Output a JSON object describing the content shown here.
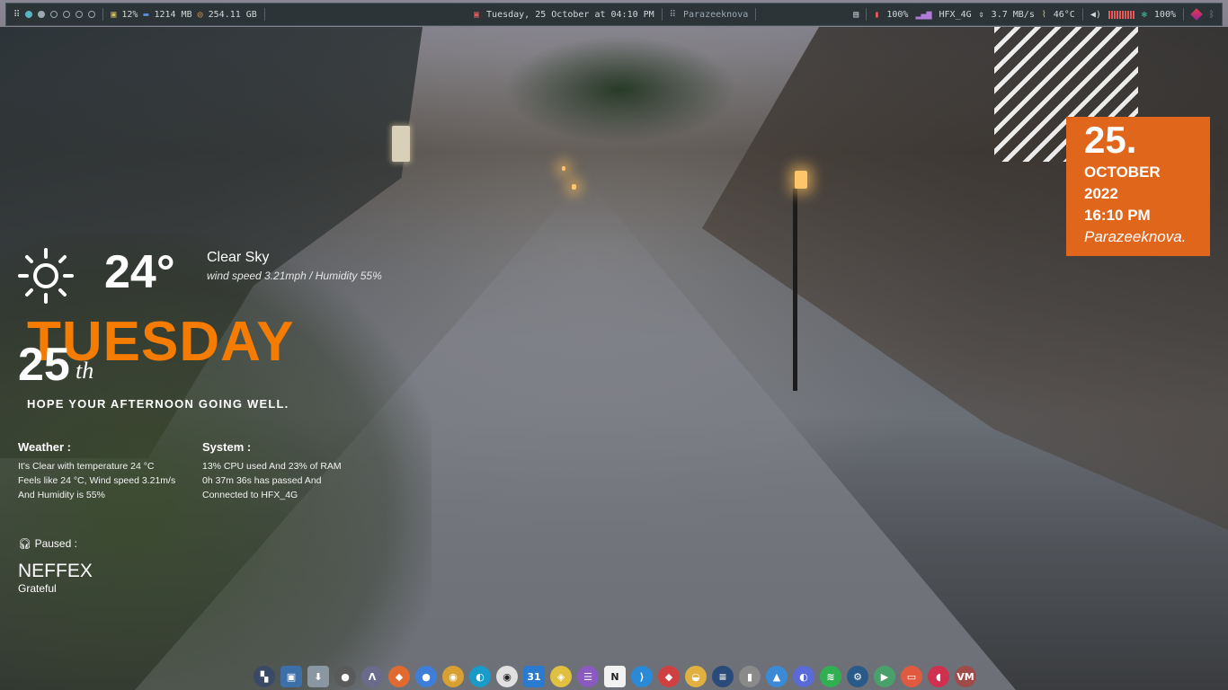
{
  "topbar": {
    "workspaces": [
      "active",
      "occupied",
      "occupied",
      "empty",
      "empty",
      "empty",
      "empty"
    ],
    "cpu": "12%",
    "ram": "1214 MB",
    "disk": "254.11 GB",
    "datetime": "Tuesday, 25 October at 04:10 PM",
    "hostname": "Parazeeknova",
    "battery": "100%",
    "network_name": "HFX_4G",
    "net_speed": "3.7 MB/s",
    "temperature": "46°C",
    "brightness": "100%",
    "volume_level": 1.0
  },
  "weather": {
    "temp": "24°",
    "condition": "Clear Sky",
    "detail": "wind speed 3.21mph / Humidity 55%"
  },
  "day": {
    "name": "TUESDAY",
    "number": "25",
    "suffix": "th",
    "greeting": "HOPE YOUR AFTERNOON  GOING WELL."
  },
  "weather_info": {
    "heading": "Weather :",
    "lines": [
      "It's Clear with temperature 24 °C",
      "Feels like 24 °C, Wind speed 3.21m/s",
      "And Humidity is 55%"
    ]
  },
  "system_info": {
    "heading": "System :",
    "lines": [
      "13% CPU used And 23% of RAM",
      "0h 37m 36s has passed And",
      "Connected to HFX_4G"
    ]
  },
  "media": {
    "status": "Paused :",
    "artist": "NEFFEX",
    "song": "Grateful"
  },
  "clock_card": {
    "date": "25.",
    "month": "OCTOBER",
    "year": "2022",
    "time": "16:10 PM",
    "user": "Parazeeknova."
  },
  "dock": [
    {
      "name": "workspace-switcher",
      "color": "#3a4a66",
      "glyph": "▚"
    },
    {
      "name": "window-manager",
      "color": "#3d6fa8",
      "glyph": "▣"
    },
    {
      "name": "downloads",
      "color": "#8a96a2",
      "glyph": "⬇"
    },
    {
      "name": "camera",
      "color": "#5a5a5a",
      "glyph": "●"
    },
    {
      "name": "archlinux",
      "color": "#6a6a8a",
      "glyph": "Λ"
    },
    {
      "name": "gitlab",
      "color": "#e06a30",
      "glyph": "◆"
    },
    {
      "name": "chromium",
      "color": "#3f7ed8",
      "glyph": "●"
    },
    {
      "name": "chrome",
      "color": "#d8a030",
      "glyph": "◉"
    },
    {
      "name": "edge",
      "color": "#1a9ac8",
      "glyph": "◐"
    },
    {
      "name": "ubuntu",
      "color": "#e0e0e0",
      "glyph": "◉"
    },
    {
      "name": "calendar",
      "color": "#2a7ad0",
      "glyph": "31"
    },
    {
      "name": "ideas",
      "color": "#e0c040",
      "glyph": "◈"
    },
    {
      "name": "tasks",
      "color": "#8a5ac0",
      "glyph": "☰"
    },
    {
      "name": "notion",
      "color": "#f2f2f2",
      "glyph": "N"
    },
    {
      "name": "vscode",
      "color": "#2a8ad8",
      "glyph": "⟩"
    },
    {
      "name": "package",
      "color": "#d04040",
      "glyph": "◆"
    },
    {
      "name": "bowl",
      "color": "#e0b040",
      "glyph": "◒"
    },
    {
      "name": "stacks",
      "color": "#2a4a7a",
      "glyph": "≡"
    },
    {
      "name": "lamp",
      "color": "#8a8a8a",
      "glyph": "▮"
    },
    {
      "name": "drive",
      "color": "#3a8ad8",
      "glyph": "▲"
    },
    {
      "name": "discord",
      "color": "#5a6ad8",
      "glyph": "◐"
    },
    {
      "name": "spotify",
      "color": "#30b050",
      "glyph": "≋"
    },
    {
      "name": "steam",
      "color": "#2a5a8a",
      "glyph": "⚙"
    },
    {
      "name": "terminal",
      "color": "#4aa06a",
      "glyph": "▶"
    },
    {
      "name": "screenshot",
      "color": "#e05a40",
      "glyph": "▭"
    },
    {
      "name": "flameshot",
      "color": "#d03050",
      "glyph": "◖"
    },
    {
      "name": "virtual-machine",
      "color": "#a04a4a",
      "glyph": "VM"
    }
  ]
}
